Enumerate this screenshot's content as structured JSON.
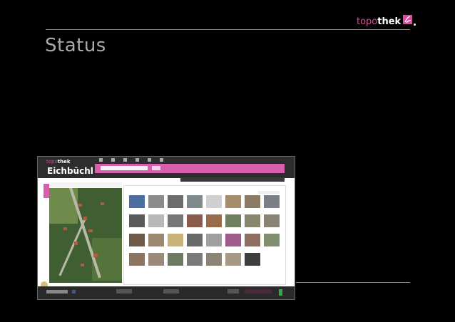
{
  "logo": {
    "part1": "topo",
    "part2": "thek"
  },
  "slide": {
    "title": "Status"
  },
  "screenshot": {
    "brand_part1": "topo",
    "brand_part2": "thek",
    "place": "Eichbüchl",
    "colors": {
      "accent": "#d85fae",
      "header": "#2d2d2d"
    }
  },
  "thumbnails": [
    {
      "row": 0,
      "col": 0,
      "color": "#4a6f9e"
    },
    {
      "row": 0,
      "col": 1,
      "color": "#8c8c8c"
    },
    {
      "row": 0,
      "col": 2,
      "color": "#6c6c6c"
    },
    {
      "row": 0,
      "col": 3,
      "color": "#7f8a8c"
    },
    {
      "row": 0,
      "col": 4,
      "color": "#cfcfcf"
    },
    {
      "row": 0,
      "col": 5,
      "color": "#a78c6b"
    },
    {
      "row": 0,
      "col": 6,
      "color": "#8c7a62"
    },
    {
      "row": 0,
      "col": 7,
      "color": "#7a7f8a"
    },
    {
      "row": 1,
      "col": 0,
      "color": "#5a5a5a"
    },
    {
      "row": 1,
      "col": 1,
      "color": "#b8b8b8"
    },
    {
      "row": 1,
      "col": 2,
      "color": "#777777"
    },
    {
      "row": 1,
      "col": 3,
      "color": "#8a5b4a"
    },
    {
      "row": 1,
      "col": 4,
      "color": "#9a6b4b"
    },
    {
      "row": 1,
      "col": 5,
      "color": "#6f7f5f"
    },
    {
      "row": 1,
      "col": 6,
      "color": "#87856c"
    },
    {
      "row": 1,
      "col": 7,
      "color": "#8a8272"
    },
    {
      "row": 2,
      "col": 0,
      "color": "#6e5a49"
    },
    {
      "row": 2,
      "col": 1,
      "color": "#9b8a70"
    },
    {
      "row": 2,
      "col": 2,
      "color": "#c9b37a"
    },
    {
      "row": 2,
      "col": 3,
      "color": "#6a6a6a"
    },
    {
      "row": 2,
      "col": 4,
      "color": "#a0a0a0"
    },
    {
      "row": 2,
      "col": 5,
      "color": "#a05a8c"
    },
    {
      "row": 2,
      "col": 6,
      "color": "#8e6f62"
    },
    {
      "row": 2,
      "col": 7,
      "color": "#7f8f6f"
    },
    {
      "row": 3,
      "col": 0,
      "color": "#8a7560"
    },
    {
      "row": 3,
      "col": 1,
      "color": "#9a8a7a"
    },
    {
      "row": 3,
      "col": 2,
      "color": "#6f7a62"
    },
    {
      "row": 3,
      "col": 3,
      "color": "#7a7a7a"
    },
    {
      "row": 3,
      "col": 4,
      "color": "#8c8474"
    },
    {
      "row": 3,
      "col": 5,
      "color": "#a69a86"
    },
    {
      "row": 3,
      "col": 6,
      "color": "#3e3e3e"
    }
  ]
}
